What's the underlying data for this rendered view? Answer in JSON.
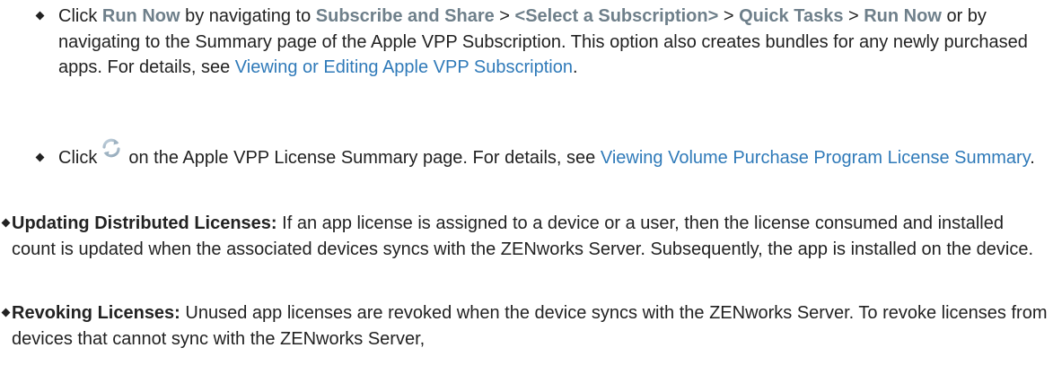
{
  "bullet1": {
    "p1": "Click ",
    "run_now": "Run Now",
    "p2": " by navigating to ",
    "subscribe": "Subscribe and Share",
    "sep1": " > ",
    "select_sub": "<Select a Subscription>",
    "sep2": " > ",
    "quick_tasks": "Quick Tasks",
    "sep3": " > ",
    "run_now2": "Run Now",
    "p3": " or by navigating to the Summary page of the Apple VPP Subscription. This option also creates bundles for any newly purchased apps. For details, see ",
    "link": "Viewing or Editing Apple VPP Subscription",
    "p4": "."
  },
  "bullet2": {
    "p1": "Click",
    "icon": "refresh-icon",
    "p2": "on the Apple VPP License Summary page. For details, see ",
    "link": "Viewing Volume Purchase Program License Summary",
    "p3": "."
  },
  "bullet3": {
    "term": "Updating Distributed Licenses:",
    "text": " If an app license is assigned to a device or a user, then the license consumed and installed count is updated when the associated devices syncs with the ZENworks Server. Subsequently, the app is installed on the device."
  },
  "bullet4": {
    "term": "Revoking Licenses:",
    "text": " Unused app licenses are revoked when the device syncs with the ZENworks Server. To revoke licenses from devices that cannot sync with the ZENworks Server,"
  },
  "colors": {
    "link": "#2f7ab9",
    "ui_label": "#6e7f8a",
    "text": "#222222"
  }
}
